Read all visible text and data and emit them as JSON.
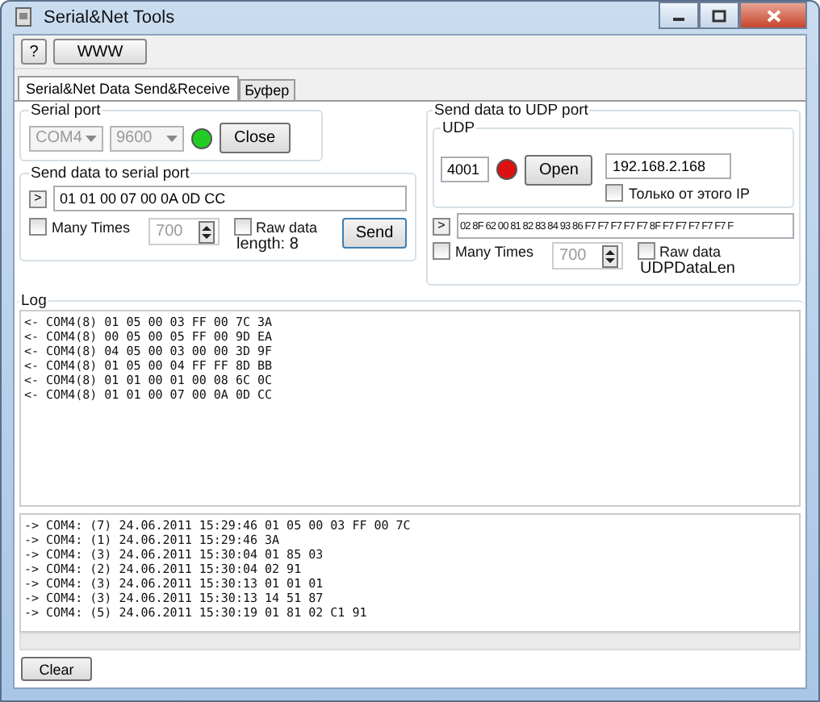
{
  "window": {
    "title": "Serial&Net Tools"
  },
  "toolbar": [
    "?",
    "WWW"
  ],
  "tabs": [
    {
      "label": "Serial&Net Data Send&Receive",
      "selected": true
    },
    {
      "label": "Буфер",
      "selected": false
    }
  ],
  "serial_port": {
    "title": "Serial port",
    "port": "COM4",
    "baud": "9600",
    "disabled": true,
    "connected": true,
    "button": "Close"
  },
  "serial_send": {
    "title": "Send data  to serial port",
    "prefix": ">",
    "value": "01 01 00 07 00 0A 0D CC",
    "many_times": {
      "label": "Many Times",
      "checked": false
    },
    "repeat": "700",
    "raw_data": {
      "label": "Raw data",
      "checked": false
    },
    "length": "length: 8",
    "button": "Send"
  },
  "udp_send": {
    "title": "Send data  to UDP port",
    "udp": {
      "title": "UDP",
      "port": "4001",
      "connected": false,
      "button": "Open",
      "ip": "192.168.2.168",
      "only_ip": {
        "label": "Только от этого IP",
        "checked": false
      }
    },
    "prefix": ">",
    "value": "02 8F 62 00 81 82 83 84 93 86 F7 F7 F7 F7 F7 8F F7 F7 F7 F7 F7 F",
    "many_times": {
      "label": "Many Times",
      "checked": false
    },
    "repeat": "700",
    "raw_data": {
      "label": "Raw data",
      "checked": false
    },
    "length": "UDPDataLen"
  },
  "log": {
    "title": "Log",
    "received": [
      "<- COM4(8) 01 05 00 03 FF 00 7C 3A",
      "<- COM4(8) 00 05 00 05 FF 00 9D EA",
      "<- COM4(8) 04 05 00 03 00 00 3D 9F",
      "<- COM4(8) 01 05 00 04 FF FF 8D BB",
      "<- COM4(8) 01 01 00 01 00 08 6C 0C",
      "<- COM4(8) 01 01 00 07 00 0A 0D CC"
    ],
    "sent": [
      "-> COM4: (7) 24.06.2011 15:29:46 01 05 00 03 FF 00 7C",
      "-> COM4: (1) 24.06.2011 15:29:46 3A",
      "-> COM4: (3) 24.06.2011 15:30:04 01 85 03",
      "-> COM4: (2) 24.06.2011 15:30:04 02 91",
      "-> COM4: (3) 24.06.2011 15:30:13 01 01 01",
      "-> COM4: (3) 24.06.2011 15:30:13 14 51 87",
      "-> COM4: (5) 24.06.2011 15:30:19 01 81 02 C1 91"
    ]
  },
  "clear": "Clear"
}
